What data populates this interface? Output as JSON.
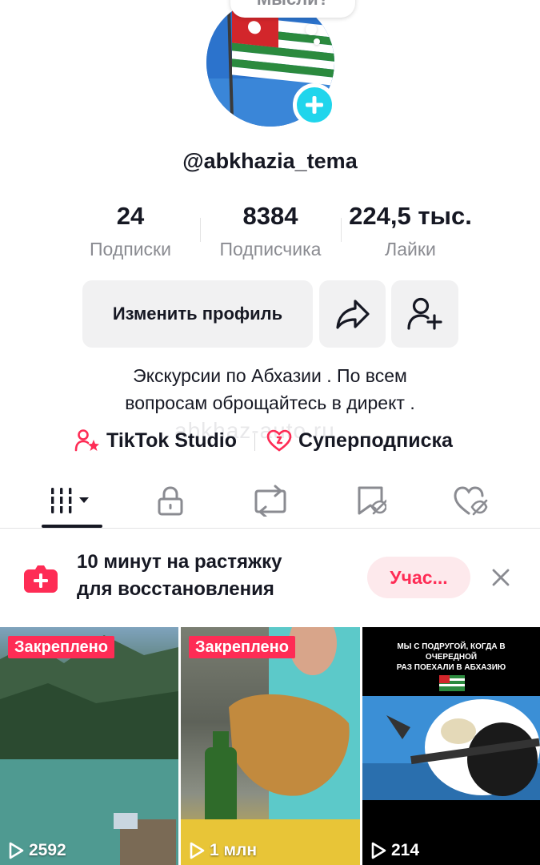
{
  "profile": {
    "thought_bubble": "Мысли?",
    "username": "@abkhazia_tema",
    "add_badge_icon": "plus-icon"
  },
  "stats": [
    {
      "value": "24",
      "label": "Подписки"
    },
    {
      "value": "8384",
      "label": "Подписчика"
    },
    {
      "value": "224,5 тыс.",
      "label": "Лайки"
    }
  ],
  "actions": {
    "edit_label": "Изменить профиль",
    "share_icon": "share-arrow-icon",
    "add_friend_icon": "add-user-icon"
  },
  "bio": {
    "line1": "Экскурсии по Абхазии .  По всем",
    "line2": "вопросам оброщайтесь в директ ."
  },
  "links": {
    "studio": "TikTok Studio",
    "super": "Суперподписка",
    "watermark": "abkhaz-auto.ru"
  },
  "tabs": [
    {
      "icon": "grid-videos-icon",
      "active": true
    },
    {
      "icon": "lock-icon",
      "active": false
    },
    {
      "icon": "repost-icon",
      "active": false
    },
    {
      "icon": "favorites-icon",
      "active": false
    },
    {
      "icon": "liked-hidden-icon",
      "active": false
    }
  ],
  "promo": {
    "text_line1": "10 минут на растяжку",
    "text_line2": "для восстановления",
    "button": "Учас...",
    "accent": "#fe2c55"
  },
  "videos": [
    {
      "pinned_label": "Закреплено",
      "views": "2592"
    },
    {
      "pinned_label": "Закреплено",
      "views": "1 млн"
    },
    {
      "caption_line1": "МЫ С ПОДРУГОЙ, КОГДА В ОЧЕРЕДНОЙ",
      "caption_line2": "РАЗ ПОЕХАЛИ В АБХАЗИЮ",
      "views": "214"
    }
  ]
}
